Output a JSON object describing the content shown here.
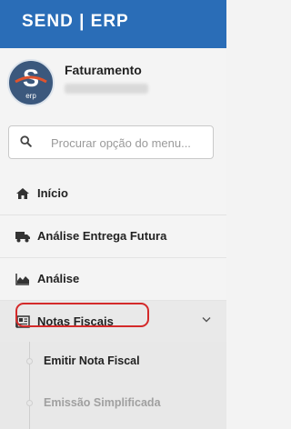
{
  "header": {
    "title": "SEND | ERP"
  },
  "profile": {
    "name": "Faturamento",
    "logo_text": "erp"
  },
  "search": {
    "placeholder": "Procurar opção do menu..."
  },
  "menu": [
    {
      "label": "Início",
      "icon": "home-icon"
    },
    {
      "label": "Análise Entrega Futura",
      "icon": "truck-icon"
    },
    {
      "label": "Análise",
      "icon": "area-chart-icon"
    },
    {
      "label": "Notas Fiscais",
      "icon": "newspaper-icon",
      "expanded": true
    }
  ],
  "submenu": [
    {
      "label": "Emitir Nota Fiscal",
      "selected": true
    },
    {
      "label": "Emissão Simplificada",
      "selected": false
    }
  ],
  "colors": {
    "header": "#2a6db7",
    "highlight": "#d42a2a",
    "logo": "#3b587d"
  }
}
